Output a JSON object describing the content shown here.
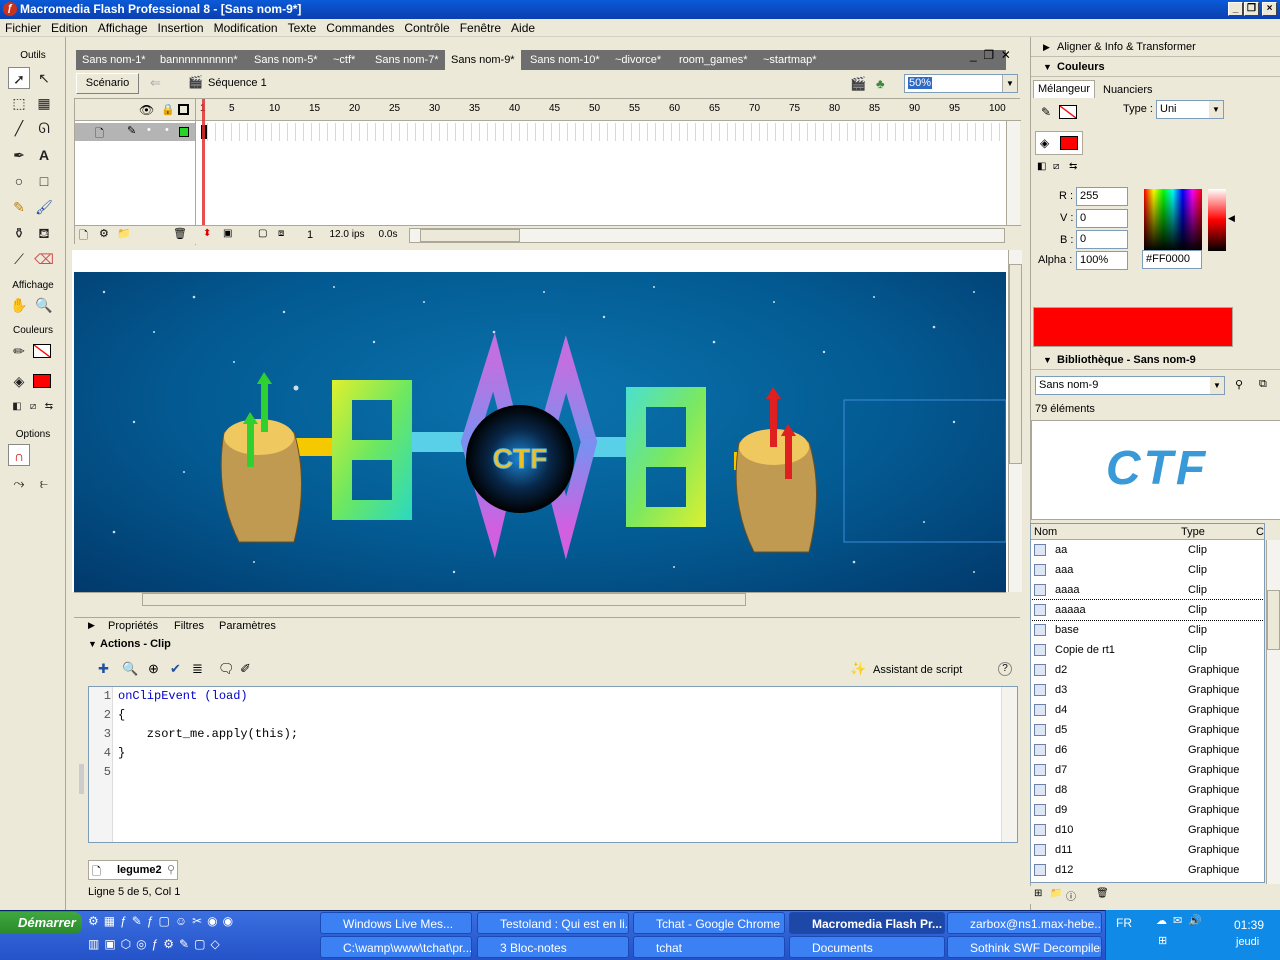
{
  "window": {
    "title": "Macromedia Flash Professional 8 - [Sans nom-9*]"
  },
  "menu": [
    "Fichier",
    "Edition",
    "Affichage",
    "Insertion",
    "Modification",
    "Texte",
    "Commandes",
    "Contrôle",
    "Fenêtre",
    "Aide"
  ],
  "tools": {
    "section_tools": "Outils",
    "section_view": "Affichage",
    "section_colors": "Couleurs",
    "section_options": "Options"
  },
  "doc_tabs": [
    "Sans nom-1*",
    "bannnnnnnnnn*",
    "Sans nom-5*",
    "~ctf*",
    "Sans nom-7*",
    "Sans nom-9*",
    "Sans nom-10*",
    "~divorce*",
    "room_games*",
    "~startmap*"
  ],
  "scene": {
    "scenario_label": "Scénario",
    "sequence_label": "Séquence 1",
    "zoom": "50%"
  },
  "timeline": {
    "frame_numbers": [
      "1",
      "5",
      "10",
      "15",
      "20",
      "25",
      "30",
      "35",
      "40",
      "45",
      "50",
      "55",
      "60",
      "65",
      "70",
      "75",
      "80",
      "85",
      "90",
      "95",
      "100"
    ],
    "current_frame": "1",
    "fps": "12.0 ips",
    "time": "0.0s"
  },
  "stage": {
    "logo_text": "CTF"
  },
  "panels": {
    "properties_tab": "Propriétés",
    "filters_tab": "Filtres",
    "params_tab": "Paramètres",
    "actions_title": "Actions - Clip",
    "script_assistant": "Assistant de script",
    "status_line": "Ligne 5 de 5, Col 1",
    "object_tab": "legume2"
  },
  "code": [
    {
      "n": "1",
      "t": "onClipEvent (load)"
    },
    {
      "n": "2",
      "t": "{"
    },
    {
      "n": "3",
      "t": "    zsort_me.apply(this);"
    },
    {
      "n": "4",
      "t": "}"
    },
    {
      "n": "5",
      "t": ""
    }
  ],
  "colors_panel": {
    "align_header": "Aligner & Info & Transformer",
    "colors_header": "Couleurs",
    "tab_mixer": "Mélangeur",
    "tab_swatches": "Nuanciers",
    "type_label": "Type :",
    "type_value": "Uni",
    "r_label": "R :",
    "r_value": "255",
    "g_label": "V :",
    "g_value": "0",
    "b_label": "B :",
    "b_value": "0",
    "alpha_label": "Alpha :",
    "alpha_value": "100%",
    "hex_value": "#FF0000",
    "fill_color": "#ff0000"
  },
  "library": {
    "header": "Bibliothèque - Sans nom-9",
    "doc_select": "Sans nom-9",
    "count": "79 éléments",
    "preview_text": "CTF",
    "col_name": "Nom",
    "col_type": "Type",
    "col_c": "C",
    "items": [
      {
        "name": "aa",
        "type": "Clip"
      },
      {
        "name": "aaa",
        "type": "Clip"
      },
      {
        "name": "aaaa",
        "type": "Clip"
      },
      {
        "name": "aaaaa",
        "type": "Clip"
      },
      {
        "name": "base",
        "type": "Clip"
      },
      {
        "name": "Copie de rt1",
        "type": "Clip"
      },
      {
        "name": "d2",
        "type": "Graphique"
      },
      {
        "name": "d3",
        "type": "Graphique"
      },
      {
        "name": "d4",
        "type": "Graphique"
      },
      {
        "name": "d5",
        "type": "Graphique"
      },
      {
        "name": "d6",
        "type": "Graphique"
      },
      {
        "name": "d7",
        "type": "Graphique"
      },
      {
        "name": "d8",
        "type": "Graphique"
      },
      {
        "name": "d9",
        "type": "Graphique"
      },
      {
        "name": "d10",
        "type": "Graphique"
      },
      {
        "name": "d11",
        "type": "Graphique"
      },
      {
        "name": "d12",
        "type": "Graphique"
      }
    ]
  },
  "taskbar": {
    "start": "Démarrer",
    "row1": [
      "Windows Live Mes...",
      "Testoland : Qui est en li...",
      "Tchat - Google Chrome",
      "Macromedia Flash Pr...",
      "zarbox@ns1.max-hebe..."
    ],
    "row2": [
      "C:\\wamp\\www\\tchat\\pr...",
      "3 Bloc-notes",
      "tchat",
      "Documents",
      "Sothink SWF Decompiler"
    ],
    "lang": "FR",
    "clock": "01:39",
    "day": "jeudi"
  }
}
